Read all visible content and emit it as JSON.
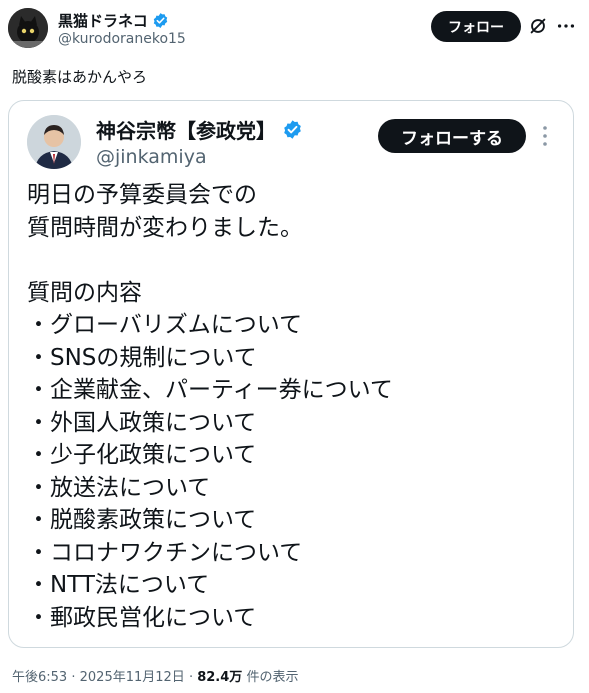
{
  "author": {
    "display_name": "黒猫ドラネコ",
    "handle": "@kurodoraneko15",
    "verified": true
  },
  "follow_label": "フォロー",
  "tweet_text": "脱酸素はあかんやろ",
  "quoted": {
    "display_name": "神谷宗幣【参政党】",
    "handle": "@jinkamiya",
    "verified": true,
    "follow_label": "フォローする",
    "intro_lines": [
      "明日の予算委員会での",
      "質問時間が変わりました。"
    ],
    "list_title": "質問の内容",
    "items": [
      "グローバリズムについて",
      "SNSの規制について",
      "企業献金、パーティー券について",
      "外国人政策について",
      "少子化政策について",
      "放送法について",
      "脱酸素政策について",
      "コロナワクチンについて",
      "NTT法について",
      "郵政民営化について"
    ]
  },
  "meta": {
    "time": "午後6:53",
    "separator": "·",
    "date": "2025年11月12日",
    "views": "82.4万",
    "views_suffix": "件の表示"
  },
  "colors": {
    "verified_blue": "#1d9bf0",
    "button_black": "#0f1419",
    "secondary_text": "#536471",
    "border": "#cfd9de"
  },
  "icons": {
    "verified": "verified-badge-icon",
    "grok": "grok-icon",
    "more": "more-dots-icon"
  }
}
